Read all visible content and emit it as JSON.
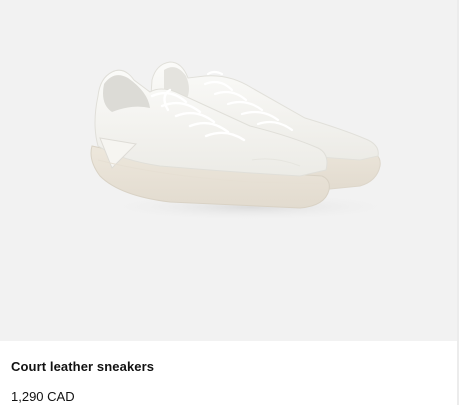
{
  "product": {
    "name": "Court leather sneakers",
    "price": "1,290 CAD",
    "image_icon": "sneaker-pair-icon"
  },
  "colors": {
    "image_background": "#f2f2f2",
    "text": "#111111"
  }
}
